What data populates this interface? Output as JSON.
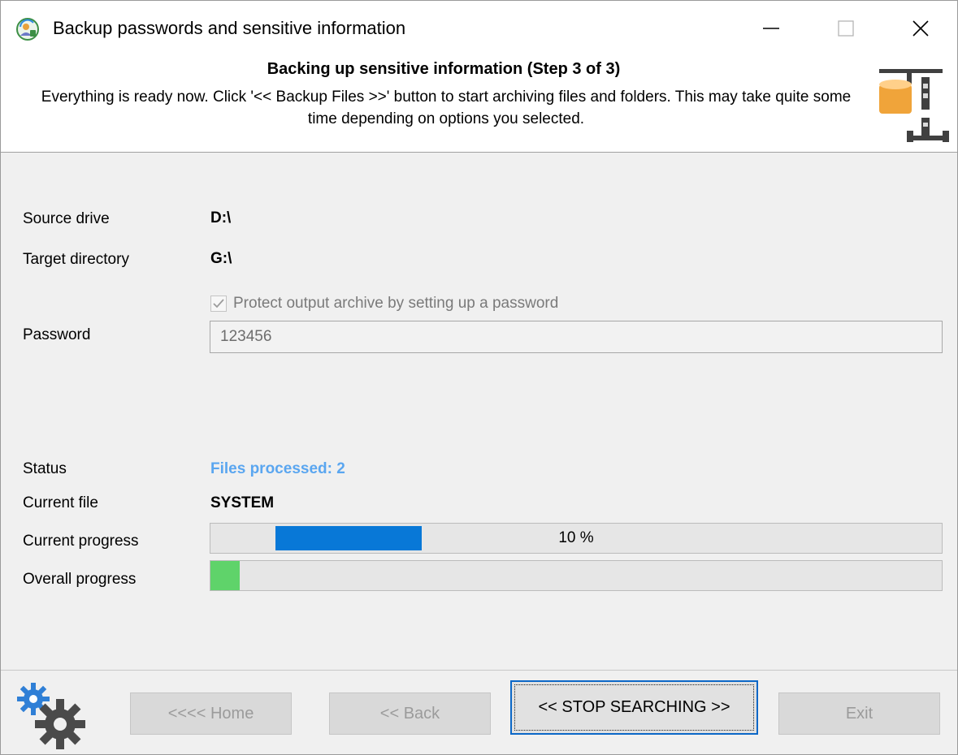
{
  "window": {
    "title": "Backup passwords and sensitive information",
    "controls": {
      "minimize": "—",
      "maximize": "☐",
      "close": "✕"
    }
  },
  "header": {
    "title": "Backing up sensitive information (Step 3 of 3)",
    "description": "Everything is ready now. Click '<< Backup Files >>' button to start archiving files and folders. This may take quite some time depending on options you selected."
  },
  "fields": {
    "source_drive_label": "Source drive",
    "source_drive_value": "D:\\",
    "target_directory_label": "Target directory",
    "target_directory_value": "G:\\",
    "protect_label": "Protect output archive by setting up a password",
    "protect_checked": true,
    "password_label": "Password",
    "password_value": "123456"
  },
  "status": {
    "status_label": "Status",
    "status_value": "Files processed: 2",
    "status_color": "#5aa6f0",
    "current_file_label": "Current file",
    "current_file_value": "SYSTEM",
    "current_progress_label": "Current progress",
    "current_progress_text": "10 %",
    "overall_progress_label": "Overall progress",
    "overall_progress_fraction": 0.04
  },
  "buttons": {
    "home": "<<<< Home",
    "back": "<< Back",
    "stop": "<< STOP SEARCHING >>",
    "exit": "Exit"
  },
  "icons": {
    "app": "user-shield-icon",
    "header": "archive-press-icon",
    "footer": "gears-icon"
  },
  "colors": {
    "progress_fill": "#0878d7",
    "overall_fill": "#5fd36a",
    "focus_border": "#0b67c7"
  }
}
